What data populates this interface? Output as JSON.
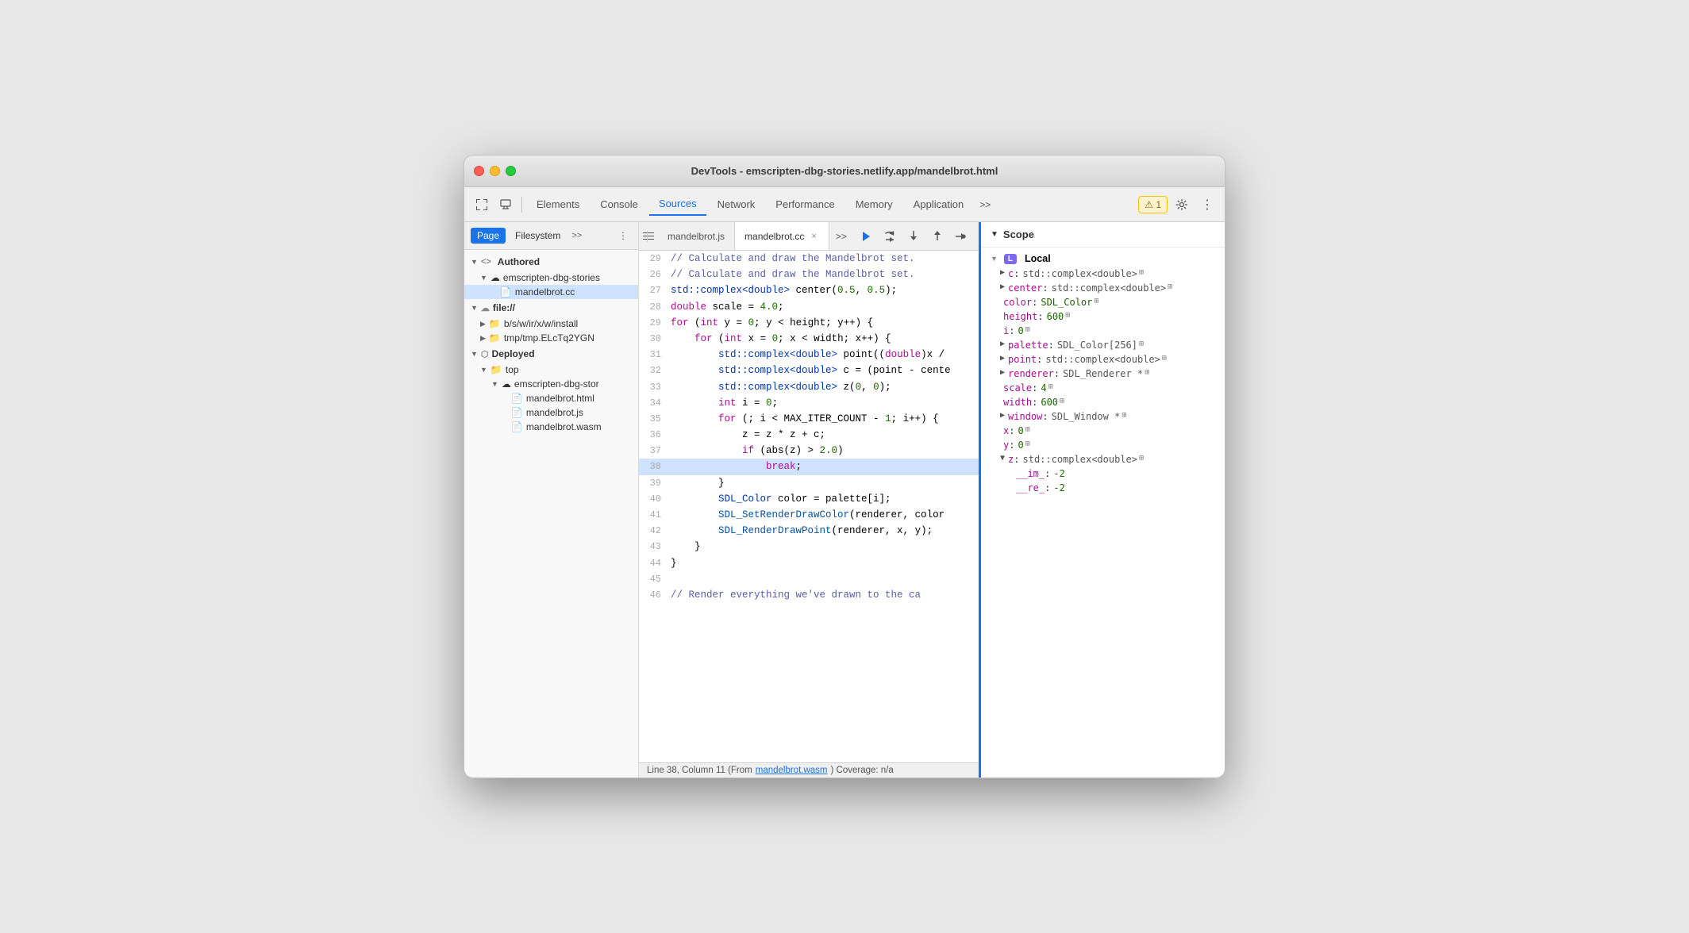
{
  "window": {
    "title": "DevTools - emscripten-dbg-stories.netlify.app/mandelbrot.html"
  },
  "tabs": {
    "items": [
      "Elements",
      "Console",
      "Sources",
      "Network",
      "Performance",
      "Memory",
      "Application"
    ],
    "active": "Sources",
    "more": ">>",
    "warning": "⚠ 1"
  },
  "sidebar": {
    "page_tab": "Page",
    "filesystem_tab": "Filesystem",
    "more": ">>",
    "tree": {
      "authored_label": "Authored",
      "cloud1_label": "emscripten-dbg-stories",
      "mandelbrot_cc": "mandelbrot.cc",
      "file_label": "file://",
      "bsw_label": "b/s/w/ir/x/w/install",
      "tmp_label": "tmp/tmp.ELcTq2YGN",
      "deployed_label": "Deployed",
      "top_label": "top",
      "cloud2_label": "emscripten-dbg-stor",
      "mandelbrot_html": "mandelbrot.html",
      "mandelbrot_js": "mandelbrot.js",
      "mandelbrot_wasm": "mandelbrot.wasm"
    }
  },
  "editor": {
    "tab1": "mandelbrot.js",
    "tab2": "mandelbrot.cc",
    "lines": [
      {
        "num": "29",
        "tokens": [
          {
            "t": "comment",
            "v": "// Calculate and draw the Mandelbrot set."
          }
        ]
      },
      {
        "num": "26",
        "tokens": [
          {
            "t": "comment",
            "v": "// Calculate and draw the Mandelbrot set."
          }
        ]
      },
      {
        "num": "27",
        "tokens": [
          {
            "t": "type",
            "v": "std::complex<double>"
          },
          {
            "t": "plain",
            "v": " center("
          },
          {
            "t": "num",
            "v": "0.5"
          },
          {
            "t": "plain",
            "v": ", "
          },
          {
            "t": "num",
            "v": "0.5"
          },
          {
            "t": "plain",
            "v": ");"
          }
        ]
      },
      {
        "num": "28",
        "tokens": [
          {
            "t": "kw",
            "v": "double"
          },
          {
            "t": "plain",
            "v": " scale = "
          },
          {
            "t": "num",
            "v": "4.0"
          },
          {
            "t": "plain",
            "v": ";"
          }
        ]
      },
      {
        "num": "29",
        "tokens": [
          {
            "t": "kw",
            "v": "for"
          },
          {
            "t": "plain",
            "v": " ("
          },
          {
            "t": "kw",
            "v": "int"
          },
          {
            "t": "plain",
            "v": " y = "
          },
          {
            "t": "num",
            "v": "0"
          },
          {
            "t": "plain",
            "v": "; y < height; y++) {"
          }
        ]
      },
      {
        "num": "30",
        "tokens": [
          {
            "t": "plain",
            "v": "    "
          },
          {
            "t": "kw",
            "v": "for"
          },
          {
            "t": "plain",
            "v": " ("
          },
          {
            "t": "kw",
            "v": "int"
          },
          {
            "t": "plain",
            "v": " x = "
          },
          {
            "t": "num",
            "v": "0"
          },
          {
            "t": "plain",
            "v": "; x < width; x++) {"
          }
        ]
      },
      {
        "num": "31",
        "tokens": [
          {
            "t": "plain",
            "v": "        "
          },
          {
            "t": "type",
            "v": "std::complex<double>"
          },
          {
            "t": "plain",
            "v": " point(("
          },
          {
            "t": "kw",
            "v": "double"
          },
          {
            "t": "plain",
            "v": ")x /"
          }
        ]
      },
      {
        "num": "32",
        "tokens": [
          {
            "t": "plain",
            "v": "        "
          },
          {
            "t": "type",
            "v": "std::complex<double>"
          },
          {
            "t": "plain",
            "v": " c = (point - cente"
          }
        ]
      },
      {
        "num": "33",
        "tokens": [
          {
            "t": "plain",
            "v": "        "
          },
          {
            "t": "type",
            "v": "std::complex<double>"
          },
          {
            "t": "plain",
            "v": " z("
          },
          {
            "t": "num",
            "v": "0"
          },
          {
            "t": "plain",
            "v": ", "
          },
          {
            "t": "num",
            "v": "0"
          },
          {
            "t": "plain",
            "v": ");"
          }
        ]
      },
      {
        "num": "34",
        "tokens": [
          {
            "t": "plain",
            "v": "        "
          },
          {
            "t": "kw",
            "v": "int"
          },
          {
            "t": "plain",
            "v": " i = "
          },
          {
            "t": "num",
            "v": "0"
          },
          {
            "t": "plain",
            "v": ";"
          }
        ]
      },
      {
        "num": "35",
        "tokens": [
          {
            "t": "plain",
            "v": "        "
          },
          {
            "t": "kw",
            "v": "for"
          },
          {
            "t": "plain",
            "v": " (; i < MAX_ITER_COUNT - "
          },
          {
            "t": "num",
            "v": "1"
          },
          {
            "t": "plain",
            "v": "; i++) {"
          }
        ]
      },
      {
        "num": "36",
        "tokens": [
          {
            "t": "plain",
            "v": "            "
          },
          {
            "t": "plain",
            "v": "z = z * z + c;"
          }
        ]
      },
      {
        "num": "37",
        "tokens": [
          {
            "t": "plain",
            "v": "            "
          },
          {
            "t": "kw",
            "v": "if"
          },
          {
            "t": "plain",
            "v": " (abs(z) > "
          },
          {
            "t": "num",
            "v": "2.0"
          },
          {
            "t": "plain",
            "v": ")"
          }
        ]
      },
      {
        "num": "38",
        "tokens": [
          {
            "t": "plain",
            "v": "                "
          },
          {
            "t": "kw2",
            "v": "break"
          },
          {
            "t": "plain",
            "v": ";"
          }
        ],
        "highlighted": true
      },
      {
        "num": "39",
        "tokens": [
          {
            "t": "plain",
            "v": "        }"
          }
        ]
      },
      {
        "num": "40",
        "tokens": [
          {
            "t": "plain",
            "v": "        "
          },
          {
            "t": "type",
            "v": "SDL_Color"
          },
          {
            "t": "plain",
            "v": " color = palette[i];"
          }
        ]
      },
      {
        "num": "41",
        "tokens": [
          {
            "t": "plain",
            "v": "        "
          },
          {
            "t": "fn",
            "v": "SDL_SetRenderDrawColor"
          },
          {
            "t": "plain",
            "v": "(renderer, color"
          }
        ]
      },
      {
        "num": "42",
        "tokens": [
          {
            "t": "plain",
            "v": "        "
          },
          {
            "t": "fn",
            "v": "SDL_RenderDrawPoint"
          },
          {
            "t": "plain",
            "v": "(renderer, x, y);"
          }
        ]
      },
      {
        "num": "43",
        "tokens": [
          {
            "t": "plain",
            "v": "    }"
          }
        ]
      },
      {
        "num": "44",
        "tokens": [
          {
            "t": "plain",
            "v": "}"
          }
        ]
      },
      {
        "num": "45",
        "tokens": []
      },
      {
        "num": "46",
        "tokens": [
          {
            "t": "comment",
            "v": "// Render everything we've drawn to the ca"
          }
        ]
      }
    ],
    "status": "Line 38, Column 11 (From mandelbrot.wasm) Coverage: n/a"
  },
  "scope": {
    "title": "Scope",
    "local_label": "Local",
    "items": [
      {
        "key": "c",
        "value": "std::complex<double>",
        "expandable": true,
        "icon": "⊞"
      },
      {
        "key": "center",
        "value": "std::complex<double>",
        "expandable": true,
        "icon": "⊞"
      },
      {
        "key": "color",
        "value": "SDL_Color",
        "expandable": false,
        "icon": "⊞"
      },
      {
        "key": "height",
        "value": "600",
        "expandable": false,
        "icon": "⊞"
      },
      {
        "key": "i",
        "value": "0",
        "expandable": false,
        "icon": "⊞"
      },
      {
        "key": "palette",
        "value": "SDL_Color[256]",
        "expandable": true,
        "icon": "⊞"
      },
      {
        "key": "point",
        "value": "std::complex<double>",
        "expandable": true,
        "icon": "⊞"
      },
      {
        "key": "renderer",
        "value": "SDL_Renderer *",
        "expandable": true,
        "icon": "⊞"
      },
      {
        "key": "scale",
        "value": "4",
        "expandable": false,
        "icon": "⊞"
      },
      {
        "key": "width",
        "value": "600",
        "expandable": false,
        "icon": "⊞"
      },
      {
        "key": "window",
        "value": "SDL_Window *",
        "expandable": true,
        "icon": "⊞"
      },
      {
        "key": "x",
        "value": "0",
        "expandable": false,
        "icon": "⊞"
      },
      {
        "key": "y",
        "value": "0",
        "expandable": false,
        "icon": "⊞"
      },
      {
        "key": "z",
        "value": "std::complex<double>",
        "expandable": true,
        "icon": "⊞"
      }
    ],
    "z_children": [
      {
        "key": "__im_",
        "value": "-2"
      },
      {
        "key": "__re_",
        "value": "-2"
      }
    ]
  },
  "icons": {
    "cursor": "⌥",
    "inspect": "□",
    "elements_icon": "‹›",
    "console_icon": ">_",
    "settings": "⚙",
    "menu": "⋮",
    "sidebar_toggle": "⊣",
    "triangle_down": "▼",
    "triangle_right": "▶",
    "cloud": "☁",
    "folder": "📁",
    "file_cc": "📄",
    "file_js": "📄",
    "file_html": "📄",
    "file_wasm": "📄",
    "play": "▶",
    "pause": "⏸",
    "step_over": "↷",
    "step_into": "↓",
    "step_out": "↑",
    "step_back": "→•←",
    "deactivate": "⊘"
  }
}
